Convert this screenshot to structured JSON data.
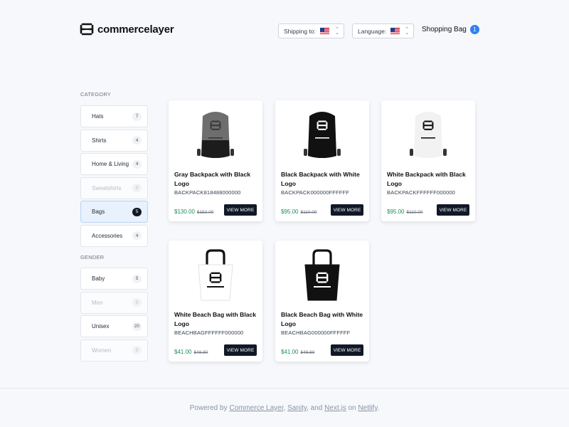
{
  "header": {
    "brand": "commercelayer",
    "shipping_label": "Shipping to:",
    "language_label": "Language:",
    "bag_label": "Shopping Bag",
    "bag_count": "1",
    "flag_icon": "us-flag-icon"
  },
  "sidebar": {
    "category_title": "CATEGORY",
    "categories": [
      {
        "label": "Hats",
        "count": "7",
        "state": "normal"
      },
      {
        "label": "Shirts",
        "count": "4",
        "state": "normal"
      },
      {
        "label": "Home & Living",
        "count": "4",
        "state": "normal"
      },
      {
        "label": "Sweatshirts",
        "count": "0",
        "state": "disabled"
      },
      {
        "label": "Bags",
        "count": "5",
        "state": "active"
      },
      {
        "label": "Accessories",
        "count": "4",
        "state": "normal"
      }
    ],
    "gender_title": "GENDER",
    "genders": [
      {
        "label": "Baby",
        "count": "5",
        "state": "normal"
      },
      {
        "label": "Men",
        "count": "0",
        "state": "disabled"
      },
      {
        "label": "Unisex",
        "count": "20",
        "state": "normal"
      },
      {
        "label": "Women",
        "count": "0",
        "state": "disabled"
      }
    ]
  },
  "products": [
    {
      "name": "Gray Backpack with Black Logo",
      "sku": "BACKPACK818488000000",
      "price": "$130.00",
      "old_price": "$152.00",
      "button": "VIEW MORE",
      "image": "gray-backpack"
    },
    {
      "name": "Black Backpack with White Logo",
      "sku": "BACKPACK000000FFFFFF",
      "price": "$95.00",
      "old_price": "$110.00",
      "button": "VIEW MORE",
      "image": "black-backpack"
    },
    {
      "name": "White Backpack with Black Logo",
      "sku": "BACKPACKFFFFFF000000",
      "price": "$95.00",
      "old_price": "$110.00",
      "button": "VIEW MORE",
      "image": "white-backpack"
    },
    {
      "name": "White Beach Bag with Black Logo",
      "sku": "BEACHBAGFFFFFF000000",
      "price": "$41.00",
      "old_price": "$48.80",
      "button": "VIEW MORE",
      "image": "white-beach-bag"
    },
    {
      "name": "Black Beach Bag with White Logo",
      "sku": "BEACHBAG000000FFFFFF",
      "price": "$41.00",
      "old_price": "$48.80",
      "button": "VIEW MORE",
      "image": "black-beach-bag"
    }
  ],
  "bag_logo_text": "commercelayer",
  "footer": {
    "prefix": "Powered by",
    "link1": "Commerce Layer",
    "sep1": ",",
    "link2": "Sanity",
    "sep2": ", and",
    "link3": "Next.js",
    "sep3": "on",
    "link4": "Netlify",
    "end": "."
  },
  "colors": {
    "accent": "#2f80ed",
    "price": "#1e8e5a",
    "button": "#111827",
    "background": "#f6f8fb"
  }
}
